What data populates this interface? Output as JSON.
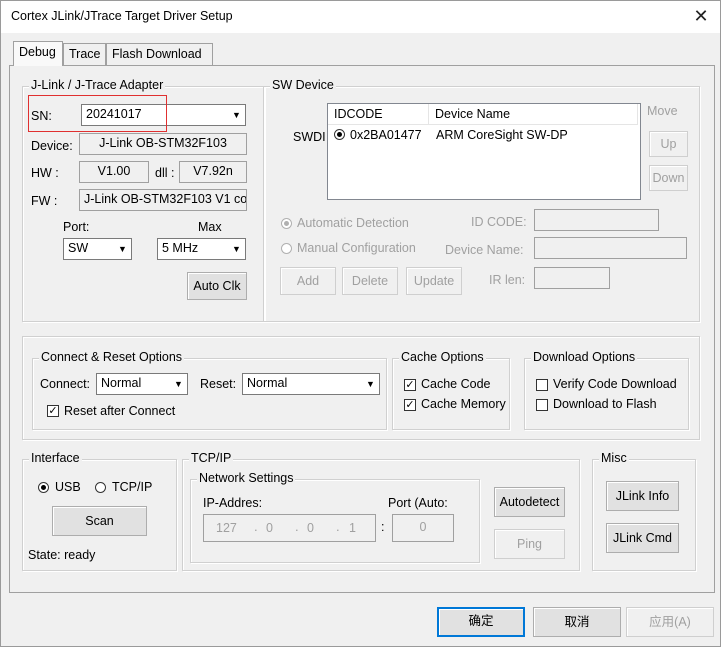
{
  "window": {
    "title": "Cortex JLink/JTrace Target Driver Setup",
    "close_glyph": "✕"
  },
  "tabs": [
    "Debug",
    "Trace",
    "Flash Download"
  ],
  "adapter": {
    "legend": "J-Link / J-Trace Adapter",
    "sn_label": "SN:",
    "sn_value": "20241017",
    "device_label": "Device:",
    "device_value": "J-Link OB-STM32F103",
    "hw_label": "HW :",
    "hw_value": "V1.00",
    "dll_label": "dll :",
    "dll_value": "V7.92n",
    "fw_label": "FW :",
    "fw_value": "J-Link OB-STM32F103 V1 co",
    "port_label": "Port:",
    "port_value": "SW",
    "max_label": "Max",
    "max_value": "5 MHz",
    "auto_clk": "Auto Clk"
  },
  "sw_device": {
    "legend": "SW Device",
    "swdi_label": "SWDI",
    "columns": [
      "IDCODE",
      "Device Name"
    ],
    "rows": [
      {
        "idcode": "0x2BA01477",
        "name": "ARM CoreSight SW-DP"
      }
    ],
    "move_label": "Move",
    "up": "Up",
    "down": "Down",
    "auto_detect": "Automatic Detection",
    "manual_config": "Manual Configuration",
    "id_code_label": "ID CODE:",
    "device_name_label": "Device Name:",
    "ir_len_label": "IR len:",
    "add": "Add",
    "delete": "Delete",
    "update": "Update"
  },
  "connect_reset": {
    "legend": "Connect & Reset Options",
    "connect_label": "Connect:",
    "connect_value": "Normal",
    "reset_label": "Reset:",
    "reset_value": "Normal",
    "reset_after_connect": "Reset after Connect",
    "reset_after_connect_checked": true
  },
  "cache": {
    "legend": "Cache Options",
    "cache_code": "Cache Code",
    "cache_code_checked": true,
    "cache_memory": "Cache Memory",
    "cache_memory_checked": true
  },
  "download": {
    "legend": "Download Options",
    "verify": "Verify Code Download",
    "verify_checked": false,
    "to_flash": "Download to Flash",
    "to_flash_checked": false
  },
  "interface": {
    "legend": "Interface",
    "usb": "USB",
    "tcpip": "TCP/IP",
    "selected": "USB",
    "scan": "Scan",
    "state": "State: ready"
  },
  "tcpip": {
    "legend": "TCP/IP",
    "network_legend": "Network Settings",
    "ip_label": "IP-Addres:",
    "port_label": "Port (Auto:",
    "ip": [
      "127",
      "0",
      "0",
      "1"
    ],
    "port": "0",
    "autodetect": "Autodetect",
    "ping": "Ping"
  },
  "misc": {
    "legend": "Misc",
    "jlink_info": "JLink Info",
    "jlink_cmd": "JLink Cmd"
  },
  "footer": {
    "ok": "确定",
    "cancel": "取消",
    "apply": "应用(A)"
  },
  "colors": {
    "highlight_box": "#e03030",
    "focus_border": "#0078d7"
  }
}
